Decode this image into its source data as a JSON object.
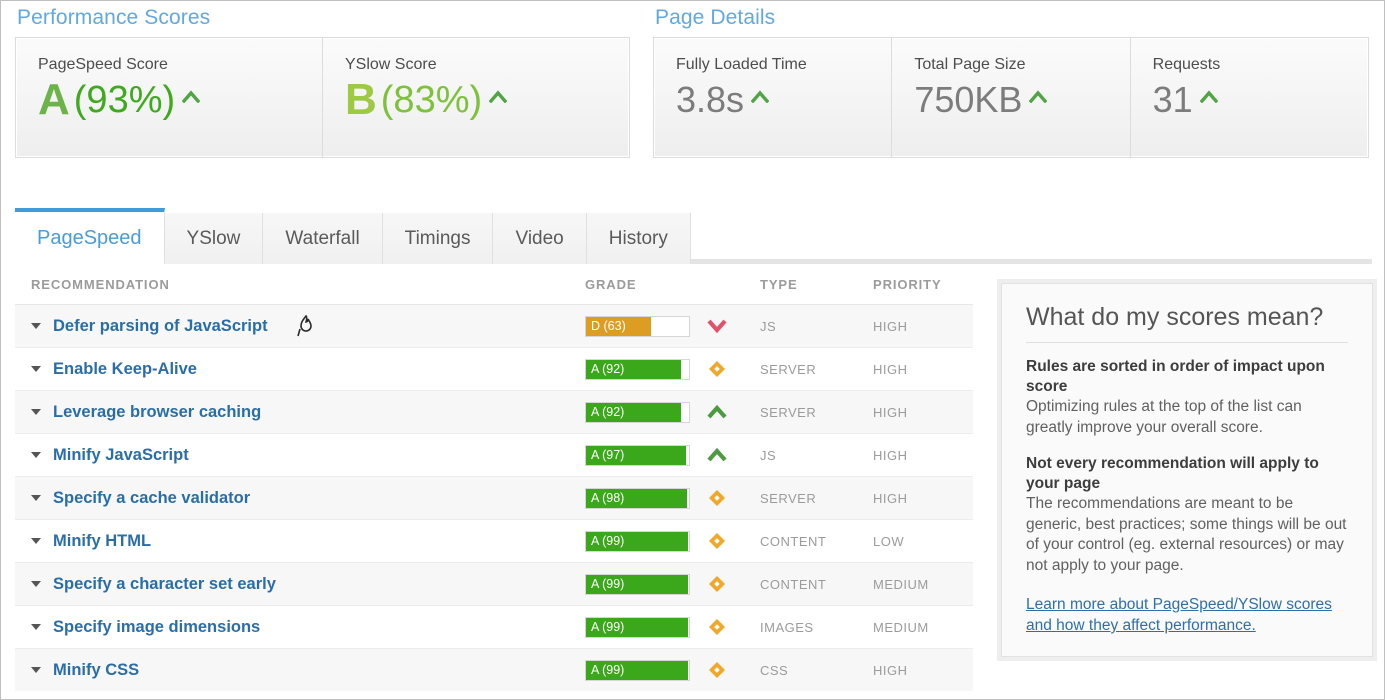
{
  "performance": {
    "section_title": "Performance Scores",
    "cards": [
      {
        "label": "PageSpeed Score",
        "grade": "A",
        "percent": "(93%)",
        "grade_color": "#6cb34a",
        "pct_color": "#3faa1e",
        "trend": "caret-up-icon"
      },
      {
        "label": "YSlow Score",
        "grade": "B",
        "percent": "(83%)",
        "grade_color": "#9dc945",
        "pct_color": "#7ec13a",
        "trend": "caret-up-icon"
      }
    ]
  },
  "page_details": {
    "section_title": "Page Details",
    "cards": [
      {
        "label": "Fully Loaded Time",
        "value": "3.8s",
        "trend": "caret-up-icon"
      },
      {
        "label": "Total Page Size",
        "value": "750KB",
        "trend": "caret-up-icon"
      },
      {
        "label": "Requests",
        "value": "31",
        "trend": "caret-up-icon"
      }
    ]
  },
  "tabs": [
    {
      "label": "PageSpeed",
      "active": true
    },
    {
      "label": "YSlow",
      "active": false
    },
    {
      "label": "Waterfall",
      "active": false
    },
    {
      "label": "Timings",
      "active": false
    },
    {
      "label": "Video",
      "active": false
    },
    {
      "label": "History",
      "active": false
    }
  ],
  "table": {
    "columns": {
      "recommendation": "RECOMMENDATION",
      "grade": "GRADE",
      "type": "TYPE",
      "priority": "PRIORITY"
    },
    "rows": [
      {
        "name": "Defer parsing of JavaScript",
        "grade_label": "D (63)",
        "score": 63,
        "bar_color": "#dd9d23",
        "trend": "chevron-down-icon",
        "trend_color": "#e2526a",
        "type": "JS",
        "priority": "HIGH"
      },
      {
        "name": "Enable Keep-Alive",
        "grade_label": "A (92)",
        "score": 92,
        "bar_color": "#3aa81a",
        "trend": "diamond-icon",
        "trend_color": "#f0a72a",
        "type": "SERVER",
        "priority": "HIGH"
      },
      {
        "name": "Leverage browser caching",
        "grade_label": "A (92)",
        "score": 92,
        "bar_color": "#3aa81a",
        "trend": "chevron-up-icon",
        "trend_color": "#4c9c3f",
        "type": "SERVER",
        "priority": "HIGH"
      },
      {
        "name": "Minify JavaScript",
        "grade_label": "A (97)",
        "score": 97,
        "bar_color": "#3aa81a",
        "trend": "chevron-up-icon",
        "trend_color": "#4c9c3f",
        "type": "JS",
        "priority": "HIGH"
      },
      {
        "name": "Specify a cache validator",
        "grade_label": "A (98)",
        "score": 98,
        "bar_color": "#3aa81a",
        "trend": "diamond-icon",
        "trend_color": "#f0a72a",
        "type": "SERVER",
        "priority": "HIGH"
      },
      {
        "name": "Minify HTML",
        "grade_label": "A (99)",
        "score": 99,
        "bar_color": "#3aa81a",
        "trend": "diamond-icon",
        "trend_color": "#f0a72a",
        "type": "CONTENT",
        "priority": "LOW"
      },
      {
        "name": "Specify a character set early",
        "grade_label": "A (99)",
        "score": 99,
        "bar_color": "#3aa81a",
        "trend": "diamond-icon",
        "trend_color": "#f0a72a",
        "type": "CONTENT",
        "priority": "MEDIUM"
      },
      {
        "name": "Specify image dimensions",
        "grade_label": "A (99)",
        "score": 99,
        "bar_color": "#3aa81a",
        "trend": "diamond-icon",
        "trend_color": "#f0a72a",
        "type": "IMAGES",
        "priority": "MEDIUM"
      },
      {
        "name": "Minify CSS",
        "grade_label": "A (99)",
        "score": 99,
        "bar_color": "#3aa81a",
        "trend": "diamond-icon",
        "trend_color": "#f0a72a",
        "type": "CSS",
        "priority": "HIGH"
      }
    ]
  },
  "side_panel": {
    "title": "What do my scores mean?",
    "blocks": [
      {
        "heading": "Rules are sorted in order of impact upon score",
        "body": "Optimizing rules at the top of the list can greatly improve your overall score."
      },
      {
        "heading": "Not every recommendation will apply to your page",
        "body": "The recommendations are meant to be generic, best practices; some things will be out of your control (eg. external resources) or may not apply to your page."
      }
    ],
    "link": "Learn more about PageSpeed/YSlow scores and how they affect performance."
  },
  "colors": {
    "accent_blue": "#63a8de",
    "tab_active_blue": "#3f9bd9",
    "link_blue": "#2f6fa8",
    "grade_green": "#3aa81a",
    "grade_orange": "#dd9d23"
  }
}
